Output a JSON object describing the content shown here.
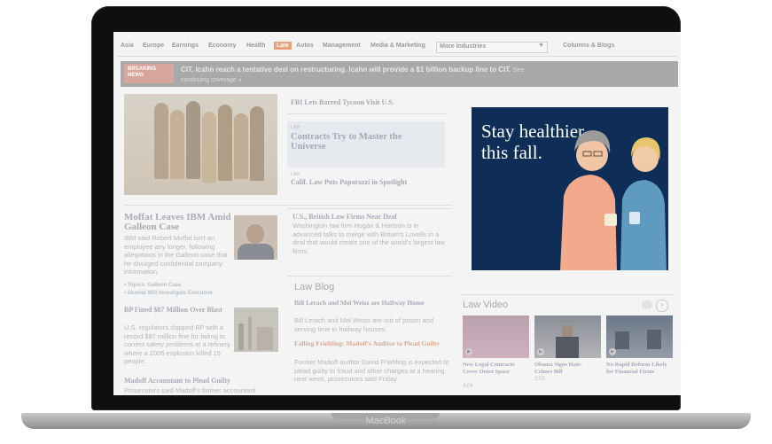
{
  "device": {
    "brand": "MacBook"
  },
  "nav": {
    "items": [
      "Asia",
      "Europe",
      "Earnings",
      "Economy",
      "Health",
      "Law",
      "Autos",
      "Management",
      "Media & Marketing"
    ],
    "active": "Law",
    "more_label": "More Industries",
    "columns_label": "Columns & Blogs"
  },
  "breaking": {
    "tag": "BREAKING NEWS",
    "headline": "CIT, Icahn reach a tentative deal on restructuring. Icahn will provide a $1 billion backup line to CIT.",
    "more": "See continuing coverage »"
  },
  "headlines": {
    "h1": "FBI Lets Barred Tycoon Visit U.S.",
    "h2_kicker": "LAW",
    "h2": "Contracts Try to Master the Universe",
    "h3_kicker": "LAW",
    "h3": "Calif. Law Puts Paparazzi in Spotlight"
  },
  "stories": {
    "moffat": {
      "title": "Moffat Leaves IBM Amid Galleon Case",
      "body": "IBM said Robert Moffat isn't an employee any longer, following allegations in the Galleon case that he divulged confidential company information.",
      "topic1": "• Topics: Galleon Case",
      "topic2": "• Akamai Will Investigate Executive"
    },
    "bp": {
      "title": "BP Fined $87 Million Over Blast",
      "body": "U.S. regulators slapped BP with a record $87 million fine for failing to correct safety problems at a refinery where a 2005 explosion killed 15 people."
    },
    "madoff_acct": {
      "title": "Madoff Accountant to Plead Guilty",
      "body": "Prosecutors said Madoff's former accountant"
    },
    "uk": {
      "title": "U.S., British Law Firms Near Deal",
      "body": "Washington law firm Hogan & Hartson is in advanced talks to merge with Britain's Lovells in a deal that would create one of the world's largest law firms."
    }
  },
  "law_blog": {
    "title": "Law Blog",
    "p1_title": "Bill Lerach and Mel Weiss are Halfway Home",
    "p1_body": "Bill Lerach and Mel Weiss are out of prison and serving time in halfway houses.",
    "p2_title": "Falling Friehling: Madoff's Auditor to Plead Guilty",
    "p2_body": "Former Madoff auditor David Friehling is expected to plead guilty to fraud and other charges at a hearing next week, prosecutors said Friday."
  },
  "law_video": {
    "title": "Law Video",
    "videos": [
      {
        "title": "New Legal Contracts Cover Outer Space",
        "time": "4:04"
      },
      {
        "title": "Obama Signs Hate-Crimes Bill",
        "time": "2:55"
      },
      {
        "title": "No Rapid Reform Likely for Financial Firms",
        "time": ""
      }
    ]
  },
  "ad": {
    "headline": "Stay healthier this fall."
  },
  "colors": {
    "screen_bg": "#f4f4f4",
    "ad_bg": "#0e2e57",
    "active_tab": "#e5a27d",
    "breaking_bar": "#a9a9a9"
  }
}
